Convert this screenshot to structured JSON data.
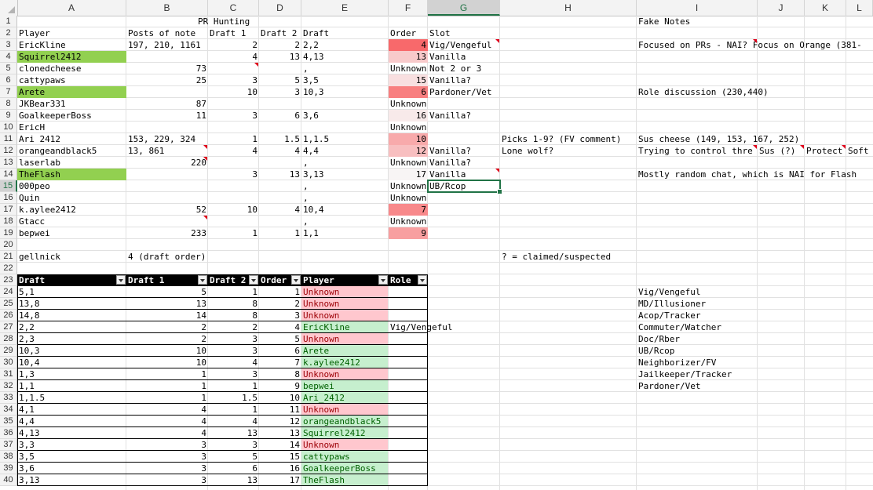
{
  "sheet": {
    "columns": [
      "A",
      "B",
      "C",
      "D",
      "E",
      "F",
      "G",
      "H",
      "I",
      "J",
      "K",
      "L"
    ],
    "selected_column": "G",
    "selected_row": "15",
    "rows": [
      "1",
      "2",
      "3",
      "4",
      "5",
      "6",
      "7",
      "8",
      "9",
      "10",
      "11",
      "12",
      "13",
      "14",
      "15",
      "16",
      "17",
      "18",
      "19",
      "20",
      "21",
      "22",
      "23",
      "24",
      "25",
      "26",
      "27",
      "28",
      "29",
      "30",
      "31",
      "32",
      "33",
      "34",
      "35",
      "36",
      "37",
      "38",
      "39",
      "40"
    ],
    "colors": {
      "selection": "#217346",
      "green_fill": "#92d050",
      "red_text": "#9c0006",
      "red_fill": "#ffc7ce",
      "green_text": "#006100",
      "green_cell": "#c6efce",
      "comment_marker": "#e0001a"
    }
  },
  "top": {
    "title": "PR Hunting",
    "fake_notes_header": "Fake Notes",
    "headers": {
      "player": "Player",
      "posts": "Posts of note",
      "draft1": "Draft 1",
      "draft2": "Draft 2",
      "draft": "Draft",
      "order": "Order",
      "slot": "Slot"
    },
    "rows": [
      {
        "row": 3,
        "player": "EricKline",
        "posts": "197, 210, 1161",
        "d1": "2",
        "d2": "2",
        "draft": "2,2",
        "order": "4",
        "slot": "Vig/Vengeful",
        "h": "",
        "i": "Focused on PRs - NAI? Focus on Orange (381-",
        "j": "",
        "k": "",
        "l": ""
      },
      {
        "row": 4,
        "player": "Squirrel2412",
        "posts": "",
        "d1": "4",
        "d2": "13",
        "draft": "4,13",
        "order": "13",
        "slot": "Vanilla",
        "h": "",
        "i": "",
        "j": "",
        "k": "",
        "l": ""
      },
      {
        "row": 5,
        "player": "clonedcheese",
        "posts": "73",
        "d1": "",
        "d2": "",
        "draft": ",",
        "order": "Unknown",
        "slot": "Not 2 or 3",
        "h": "",
        "i": "",
        "j": "",
        "k": "",
        "l": ""
      },
      {
        "row": 6,
        "player": "cattypaws",
        "posts": "25",
        "d1": "3",
        "d2": "5",
        "draft": "3,5",
        "order": "15",
        "slot": "Vanilla?",
        "h": "",
        "i": "",
        "j": "",
        "k": "",
        "l": ""
      },
      {
        "row": 7,
        "player": "Arete",
        "posts": "",
        "d1": "10",
        "d2": "3",
        "draft": "10,3",
        "order": "6",
        "slot": "Pardoner/Vet",
        "h": "",
        "i": "Role discussion (230,440)",
        "j": "",
        "k": "",
        "l": ""
      },
      {
        "row": 8,
        "player": "JKBear331",
        "posts": "87",
        "d1": "",
        "d2": "",
        "draft": "",
        "order": "Unknown",
        "slot": "",
        "h": "",
        "i": "",
        "j": "",
        "k": "",
        "l": ""
      },
      {
        "row": 9,
        "player": "GoalkeeperBoss",
        "posts": "11",
        "d1": "3",
        "d2": "6",
        "draft": "3,6",
        "order": "16",
        "slot": "Vanilla?",
        "h": "",
        "i": "",
        "j": "",
        "k": "",
        "l": ""
      },
      {
        "row": 10,
        "player": "EricH",
        "posts": "",
        "d1": "",
        "d2": "",
        "draft": "",
        "order": "Unknown",
        "slot": "",
        "h": "",
        "i": "",
        "j": "",
        "k": "",
        "l": ""
      },
      {
        "row": 11,
        "player": "Ari 2412",
        "posts": "153, 229, 324",
        "d1": "1",
        "d2": "1.5",
        "draft": "1,1.5",
        "order": "10",
        "slot": "",
        "h": "Picks 1-9? (FV comment)",
        "i": "Sus cheese (149, 153, 167, 252)",
        "j": "",
        "k": "",
        "l": ""
      },
      {
        "row": 12,
        "player": "orangeandblack5",
        "posts": "13, 861",
        "d1": "4",
        "d2": "4",
        "draft": "4,4",
        "order": "12",
        "slot": "Vanilla?",
        "h": "Lone wolf?",
        "i": "Trying to control thre",
        "j": "Sus (?)",
        "k": "Protect",
        "l": "Soft"
      },
      {
        "row": 13,
        "player": "laserlab",
        "posts": "220",
        "d1": "",
        "d2": "",
        "draft": ",",
        "order": "Unknown",
        "slot": "Vanilla?",
        "h": "",
        "i": "",
        "j": "",
        "k": "",
        "l": ""
      },
      {
        "row": 14,
        "player": "TheFlash",
        "posts": "",
        "d1": "3",
        "d2": "13",
        "draft": "3,13",
        "order": "17",
        "slot": "Vanilla",
        "h": "",
        "i": "Mostly random chat, which is NAI for Flash",
        "j": "",
        "k": "",
        "l": ""
      },
      {
        "row": 15,
        "player": "000peo",
        "posts": "",
        "d1": "",
        "d2": "",
        "draft": ",",
        "order": "Unknown",
        "slot": "UB/Rcop",
        "h": "",
        "i": "",
        "j": "",
        "k": "",
        "l": ""
      },
      {
        "row": 16,
        "player": "Quin",
        "posts": "",
        "d1": "",
        "d2": "",
        "draft": ",",
        "order": "Unknown",
        "slot": "",
        "h": "",
        "i": "",
        "j": "",
        "k": "",
        "l": ""
      },
      {
        "row": 17,
        "player": "k.aylee2412",
        "posts": "52",
        "d1": "10",
        "d2": "4",
        "draft": "10,4",
        "order": "7",
        "slot": "",
        "h": "",
        "i": "",
        "j": "",
        "k": "",
        "l": ""
      },
      {
        "row": 18,
        "player": "Gtacc",
        "posts": "",
        "d1": "",
        "d2": "",
        "draft": ",",
        "order": "Unknown",
        "slot": "",
        "h": "",
        "i": "",
        "j": "",
        "k": "",
        "l": ""
      },
      {
        "row": 19,
        "player": "bepwei",
        "posts": "233",
        "d1": "1",
        "d2": "1",
        "draft": "1,1",
        "order": "9",
        "slot": "",
        "h": "",
        "i": "",
        "j": "",
        "k": "",
        "l": ""
      }
    ],
    "row21": {
      "player": "gellnick",
      "posts": "4 (draft order)",
      "note": "? = claimed/suspected"
    }
  },
  "table": {
    "headers": [
      "Draft",
      "Draft 1",
      "Draft 2",
      "Order",
      "Player",
      "Role"
    ],
    "rows": [
      {
        "draft": "5,1",
        "d1": "5",
        "d2": "1",
        "order": "1",
        "player": "Unknown",
        "role": ""
      },
      {
        "draft": "13,8",
        "d1": "13",
        "d2": "8",
        "order": "2",
        "player": "Unknown",
        "role": ""
      },
      {
        "draft": "14,8",
        "d1": "14",
        "d2": "8",
        "order": "3",
        "player": "Unknown",
        "role": ""
      },
      {
        "draft": "2,2",
        "d1": "2",
        "d2": "2",
        "order": "4",
        "player": "EricKline",
        "role": "Vig/Vengeful"
      },
      {
        "draft": "2,3",
        "d1": "2",
        "d2": "3",
        "order": "5",
        "player": "Unknown",
        "role": ""
      },
      {
        "draft": "10,3",
        "d1": "10",
        "d2": "3",
        "order": "6",
        "player": "Arete",
        "role": ""
      },
      {
        "draft": "10,4",
        "d1": "10",
        "d2": "4",
        "order": "7",
        "player": "k.aylee2412",
        "role": ""
      },
      {
        "draft": "1,3",
        "d1": "1",
        "d2": "3",
        "order": "8",
        "player": "Unknown",
        "role": ""
      },
      {
        "draft": "1,1",
        "d1": "1",
        "d2": "1",
        "order": "9",
        "player": "bepwei",
        "role": ""
      },
      {
        "draft": "1,1.5",
        "d1": "1",
        "d2": "1.5",
        "order": "10",
        "player": "Ari_2412",
        "role": ""
      },
      {
        "draft": "4,1",
        "d1": "4",
        "d2": "1",
        "order": "11",
        "player": "Unknown",
        "role": ""
      },
      {
        "draft": "4,4",
        "d1": "4",
        "d2": "4",
        "order": "12",
        "player": "orangeandblack5",
        "role": ""
      },
      {
        "draft": "4,13",
        "d1": "4",
        "d2": "13",
        "order": "13",
        "player": "Squirrel2412",
        "role": ""
      },
      {
        "draft": "3,3",
        "d1": "3",
        "d2": "3",
        "order": "14",
        "player": "Unknown",
        "role": ""
      },
      {
        "draft": "3,5",
        "d1": "3",
        "d2": "5",
        "order": "15",
        "player": "cattypaws",
        "role": ""
      },
      {
        "draft": "3,6",
        "d1": "3",
        "d2": "6",
        "order": "16",
        "player": "GoalkeeperBoss",
        "role": ""
      },
      {
        "draft": "3,13",
        "d1": "3",
        "d2": "13",
        "order": "17",
        "player": "TheFlash",
        "role": ""
      }
    ]
  },
  "roles_list": [
    "Vig/Vengeful",
    "MD/Illusioner",
    "Acop/Tracker",
    "Commuter/Watcher",
    "Doc/Rber",
    "UB/Rcop",
    "Neighborizer/FV",
    "Jailkeeper/Tracker",
    "Pardoner/Vet"
  ]
}
